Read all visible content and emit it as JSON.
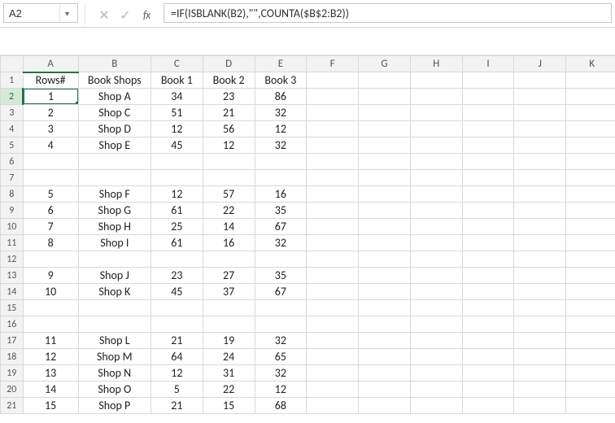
{
  "name_box": {
    "value": "A2"
  },
  "formula_bar": {
    "value": "=IF(ISBLANK(B2),\"\",COUNTA($B$2:B2))"
  },
  "icons": {
    "cancel": "✕",
    "confirm": "✓",
    "fx": "fx",
    "dropdown": "▾"
  },
  "columns": [
    "A",
    "B",
    "C",
    "D",
    "E",
    "F",
    "G",
    "H",
    "I",
    "J",
    "K"
  ],
  "active": {
    "col": "A",
    "row": 2
  },
  "rows": [
    {
      "num": 1,
      "A": "Rows#",
      "B": "Book Shops",
      "C": "Book 1",
      "D": "Book 2",
      "E": "Book 3"
    },
    {
      "num": 2,
      "A": "1",
      "B": "Shop A",
      "C": "34",
      "D": "23",
      "E": "86"
    },
    {
      "num": 3,
      "A": "2",
      "B": "Shop C",
      "C": "51",
      "D": "21",
      "E": "32"
    },
    {
      "num": 4,
      "A": "3",
      "B": "Shop D",
      "C": "12",
      "D": "56",
      "E": "12"
    },
    {
      "num": 5,
      "A": "4",
      "B": "Shop E",
      "C": "45",
      "D": "12",
      "E": "32"
    },
    {
      "num": 6,
      "A": "",
      "B": "",
      "C": "",
      "D": "",
      "E": ""
    },
    {
      "num": 7,
      "A": "",
      "B": "",
      "C": "",
      "D": "",
      "E": ""
    },
    {
      "num": 8,
      "A": "5",
      "B": "Shop F",
      "C": "12",
      "D": "57",
      "E": "16"
    },
    {
      "num": 9,
      "A": "6",
      "B": "Shop G",
      "C": "61",
      "D": "22",
      "E": "35"
    },
    {
      "num": 10,
      "A": "7",
      "B": "Shop H",
      "C": "25",
      "D": "14",
      "E": "67"
    },
    {
      "num": 11,
      "A": "8",
      "B": "Shop I",
      "C": "61",
      "D": "16",
      "E": "32"
    },
    {
      "num": 12,
      "A": "",
      "B": "",
      "C": "",
      "D": "",
      "E": ""
    },
    {
      "num": 13,
      "A": "9",
      "B": "Shop J",
      "C": "23",
      "D": "27",
      "E": "35"
    },
    {
      "num": 14,
      "A": "10",
      "B": "Shop K",
      "C": "45",
      "D": "37",
      "E": "67"
    },
    {
      "num": 15,
      "A": "",
      "B": "",
      "C": "",
      "D": "",
      "E": ""
    },
    {
      "num": 16,
      "A": "",
      "B": "",
      "C": "",
      "D": "",
      "E": ""
    },
    {
      "num": 17,
      "A": "11",
      "B": "Shop L",
      "C": "21",
      "D": "19",
      "E": "32"
    },
    {
      "num": 18,
      "A": "12",
      "B": "Shop M",
      "C": "64",
      "D": "24",
      "E": "65"
    },
    {
      "num": 19,
      "A": "13",
      "B": "Shop N",
      "C": "12",
      "D": "31",
      "E": "32"
    },
    {
      "num": 20,
      "A": "14",
      "B": "Shop O",
      "C": "5",
      "D": "22",
      "E": "12"
    },
    {
      "num": 21,
      "A": "15",
      "B": "Shop P",
      "C": "21",
      "D": "15",
      "E": "68"
    }
  ]
}
